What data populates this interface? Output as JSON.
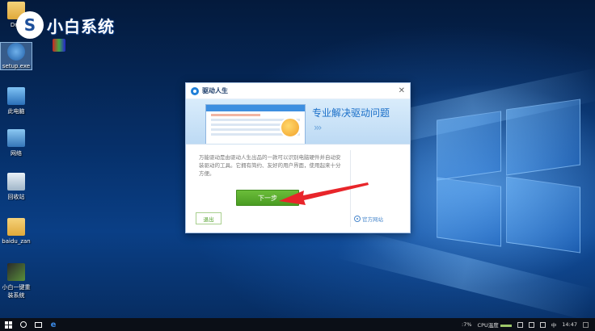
{
  "watermark": {
    "logo_letter": "S",
    "text": "小白系统"
  },
  "desktop_icons": [
    {
      "label": "Driv",
      "icon": "folder-icon"
    },
    {
      "label": "setup.exe",
      "icon": "gear-icon"
    },
    {
      "label": "此电脑",
      "icon": "computer-icon"
    },
    {
      "label": "网络",
      "icon": "network-icon"
    },
    {
      "label": "回收站",
      "icon": "recycle-bin-icon"
    },
    {
      "label": "baidu_zan",
      "icon": "folder-icon"
    },
    {
      "label": "小白一键重装系统",
      "icon": "app-icon"
    }
  ],
  "dialog": {
    "title": "驱动人生",
    "close_glyph": "✕",
    "banner_text": "专业解决驱动问题",
    "banner_chevron": "›››",
    "description": "万能驱动是由驱动人生出品的一款可以识别电脑硬件并自动安装驱动的工具。它拥有简约、友好的用户界面，使用起来十分方便。",
    "next_button": "下一步",
    "exit_button": "退出",
    "site_link": "官方网站"
  },
  "taskbar": {
    "battery_percent": ":7%",
    "cpu_label": "CPU温度",
    "ime_label": "中",
    "time": "14:47"
  },
  "colors": {
    "accent_green": "#4a9c22",
    "title_blue": "#1b3c6a",
    "banner_blue": "#1a6fc8",
    "arrow_red": "#e8252a"
  }
}
